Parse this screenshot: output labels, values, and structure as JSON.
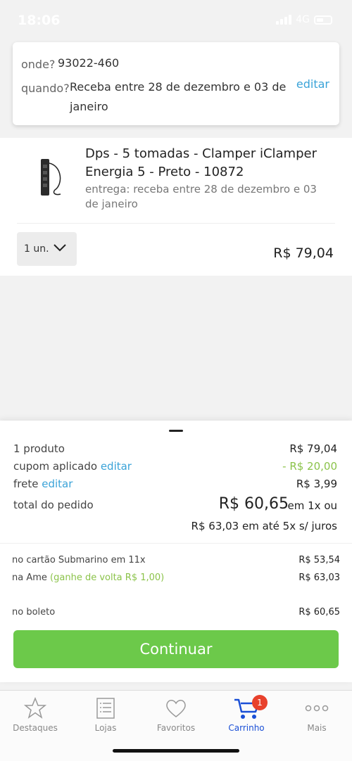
{
  "status_bar": {
    "time": "18:06",
    "network": "4G"
  },
  "delivery": {
    "where_label": "onde?",
    "where_value": "93022-460",
    "when_label": "quando?",
    "when_line1": "Receba entre 28 de dezembro e 03 de",
    "when_line2": "janeiro",
    "edit_label": "editar"
  },
  "product": {
    "name_line1": "Dps - 5 tomadas - Clamper iClamper",
    "name_line2": "Energia 5 - Preto - 10872",
    "delivery_line1": "entrega: receba entre 28 de dezembro e 03",
    "delivery_line2": "de janeiro",
    "quantity": "1 un.",
    "price": "R$ 79,04"
  },
  "summary": {
    "products_label": "1 produto",
    "products_value": "R$ 79,04",
    "coupon_label": "cupom aplicado",
    "coupon_edit": "editar",
    "coupon_value": "- R$ 20,00",
    "shipping_label": "frete",
    "shipping_edit": "editar",
    "shipping_value": "R$ 3,99",
    "total_label": "total do pedido",
    "total_value": "R$ 60,65",
    "total_suffix": "em 1x ou",
    "installments": "R$ 63,03 em até 5x s/ juros"
  },
  "payment_options": {
    "card_label": "no cartão Submarino em 11x",
    "card_value": "R$ 53,54",
    "ame_label": "na Ame",
    "ame_cashback": "(ganhe de volta R$ 1,00)",
    "ame_value": "R$ 63,03",
    "boleto_label": "no boleto",
    "boleto_value": "R$ 60,65"
  },
  "continue_label": "Continuar",
  "tabs": [
    {
      "label": "Destaques",
      "icon": "star-icon"
    },
    {
      "label": "Lojas",
      "icon": "list-icon"
    },
    {
      "label": "Favoritos",
      "icon": "heart-icon"
    },
    {
      "label": "Carrinho",
      "icon": "cart-icon",
      "badge": "1"
    },
    {
      "label": "Mais",
      "icon": "more-icon"
    }
  ],
  "colors": {
    "accent_link": "#3aa3d8",
    "continue_button": "#6cc94a",
    "active_tab": "#1a4fd6",
    "badge": "#e8412c",
    "discount": "#8bc34a"
  }
}
